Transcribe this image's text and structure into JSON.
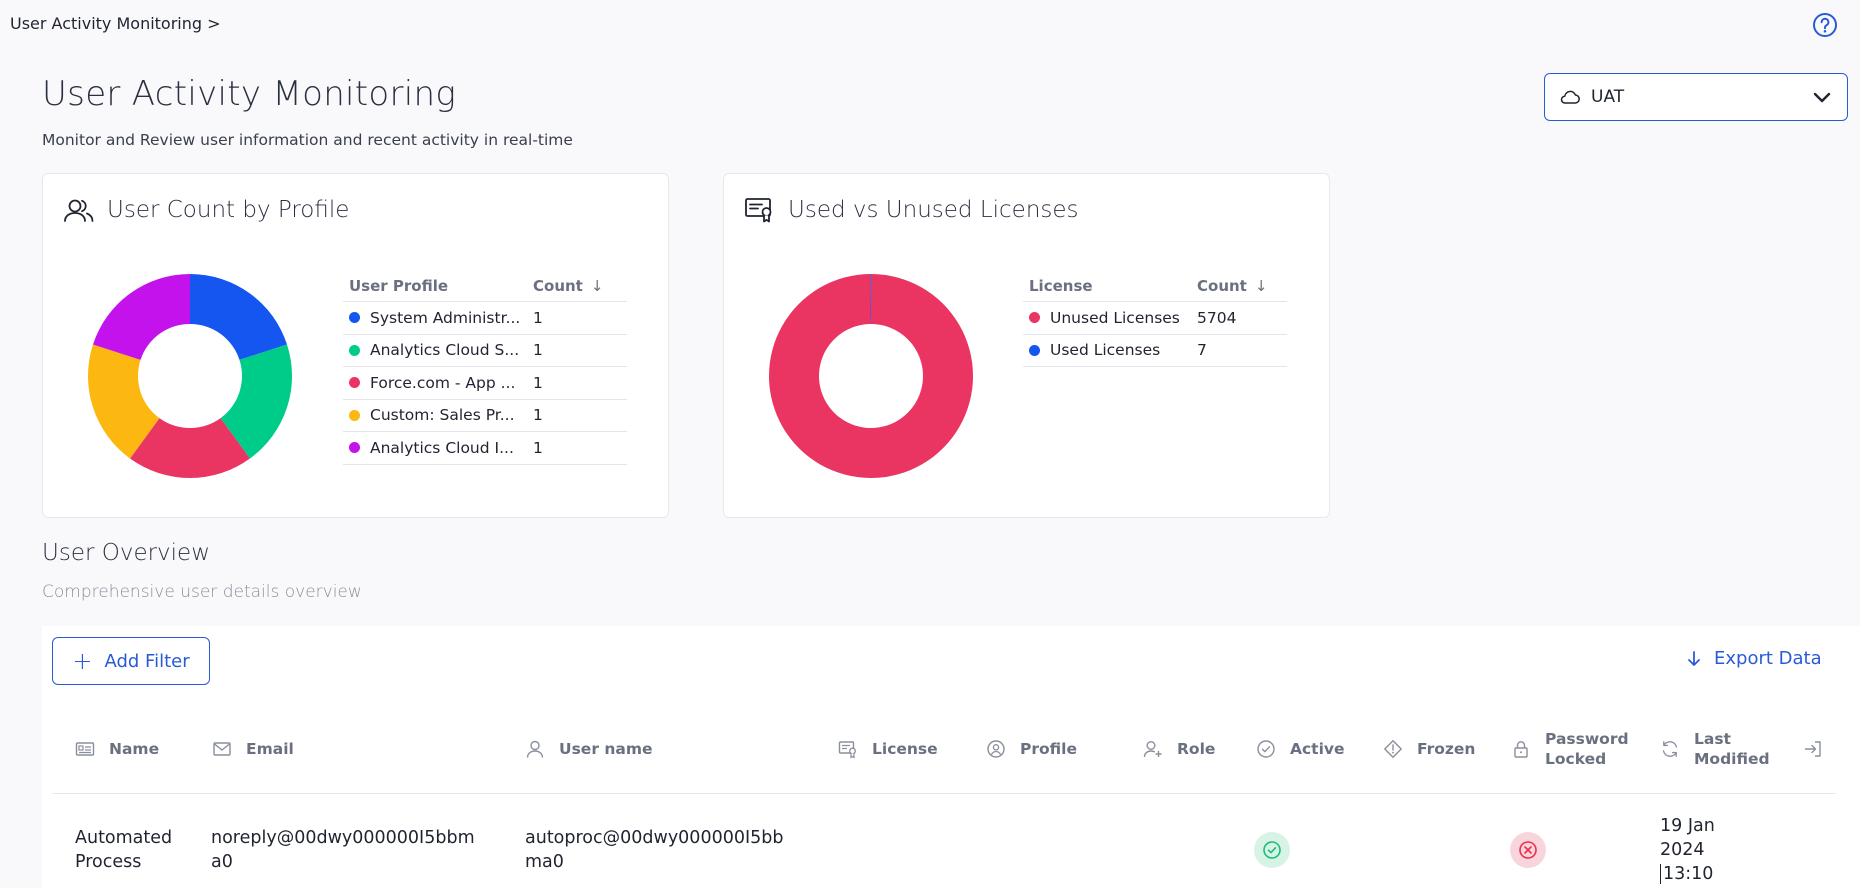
{
  "breadcrumb": "User Activity Monitoring  >",
  "page": {
    "title": "User Activity Monitoring",
    "subtitle": "Monitor and Review user information and recent activity in real-time"
  },
  "env_select": {
    "value": "UAT"
  },
  "card_profiles": {
    "title": "User Count by Profile",
    "col_profile": "User Profile",
    "col_count": "Count",
    "rows": [
      {
        "label": "System Administr...",
        "count": "1",
        "color": "#1556f0"
      },
      {
        "label": "Analytics Cloud S...",
        "count": "1",
        "color": "#00cc8a"
      },
      {
        "label": "Force.com - App ...",
        "count": "1",
        "color": "#ea3562"
      },
      {
        "label": "Custom: Sales Pr...",
        "count": "1",
        "color": "#fcb711"
      },
      {
        "label": "Analytics Cloud I...",
        "count": "1",
        "color": "#c312ec"
      }
    ]
  },
  "card_licenses": {
    "title": "Used vs Unused Licenses",
    "col_license": "License",
    "col_count": "Count",
    "rows": [
      {
        "label": "Unused Licenses",
        "count": "5704",
        "color": "#ea3562"
      },
      {
        "label": "Used Licenses",
        "count": "7",
        "color": "#1556f0"
      }
    ]
  },
  "overview": {
    "title": "User Overview",
    "subtitle": "Comprehensive user details overview",
    "add_filter": "Add Filter",
    "export": "Export Data",
    "columns": {
      "name": "Name",
      "email": "Email",
      "username": "User name",
      "license": "License",
      "profile": "Profile",
      "role": "Role",
      "active": "Active",
      "frozen": "Frozen",
      "password_locked_1": "Password",
      "password_locked_2": "Locked",
      "last_modified_1": "Last",
      "last_modified_2": "Modified"
    },
    "row": {
      "name_1": "Automated",
      "name_2": "Process",
      "email_1": "noreply@00dwy000000I5bbm",
      "email_2": "a0",
      "username_1": "autoproc@00dwy000000I5bb",
      "username_2": "ma0",
      "active": true,
      "password_locked": false,
      "modified_1": "19 Jan",
      "modified_2": "2024",
      "modified_3": "13:10"
    }
  },
  "colors": {
    "accent": "#2a5bd7",
    "success_bg": "#d7f3e6",
    "success": "#1bbf7a",
    "danger_bg": "#f8d5dc",
    "danger": "#e8304f"
  },
  "chart_data": [
    {
      "type": "pie",
      "donut": true,
      "title": "User Count by Profile",
      "categories": [
        "System Administr...",
        "Analytics Cloud S...",
        "Force.com - App ...",
        "Custom: Sales Pr...",
        "Analytics Cloud I..."
      ],
      "values": [
        1,
        1,
        1,
        1,
        1
      ],
      "colors": [
        "#1556f0",
        "#00cc8a",
        "#ea3562",
        "#fcb711",
        "#c312ec"
      ]
    },
    {
      "type": "pie",
      "donut": true,
      "title": "Used vs Unused Licenses",
      "categories": [
        "Unused Licenses",
        "Used Licenses"
      ],
      "values": [
        5704,
        7
      ],
      "colors": [
        "#ea3562",
        "#1556f0"
      ]
    }
  ]
}
